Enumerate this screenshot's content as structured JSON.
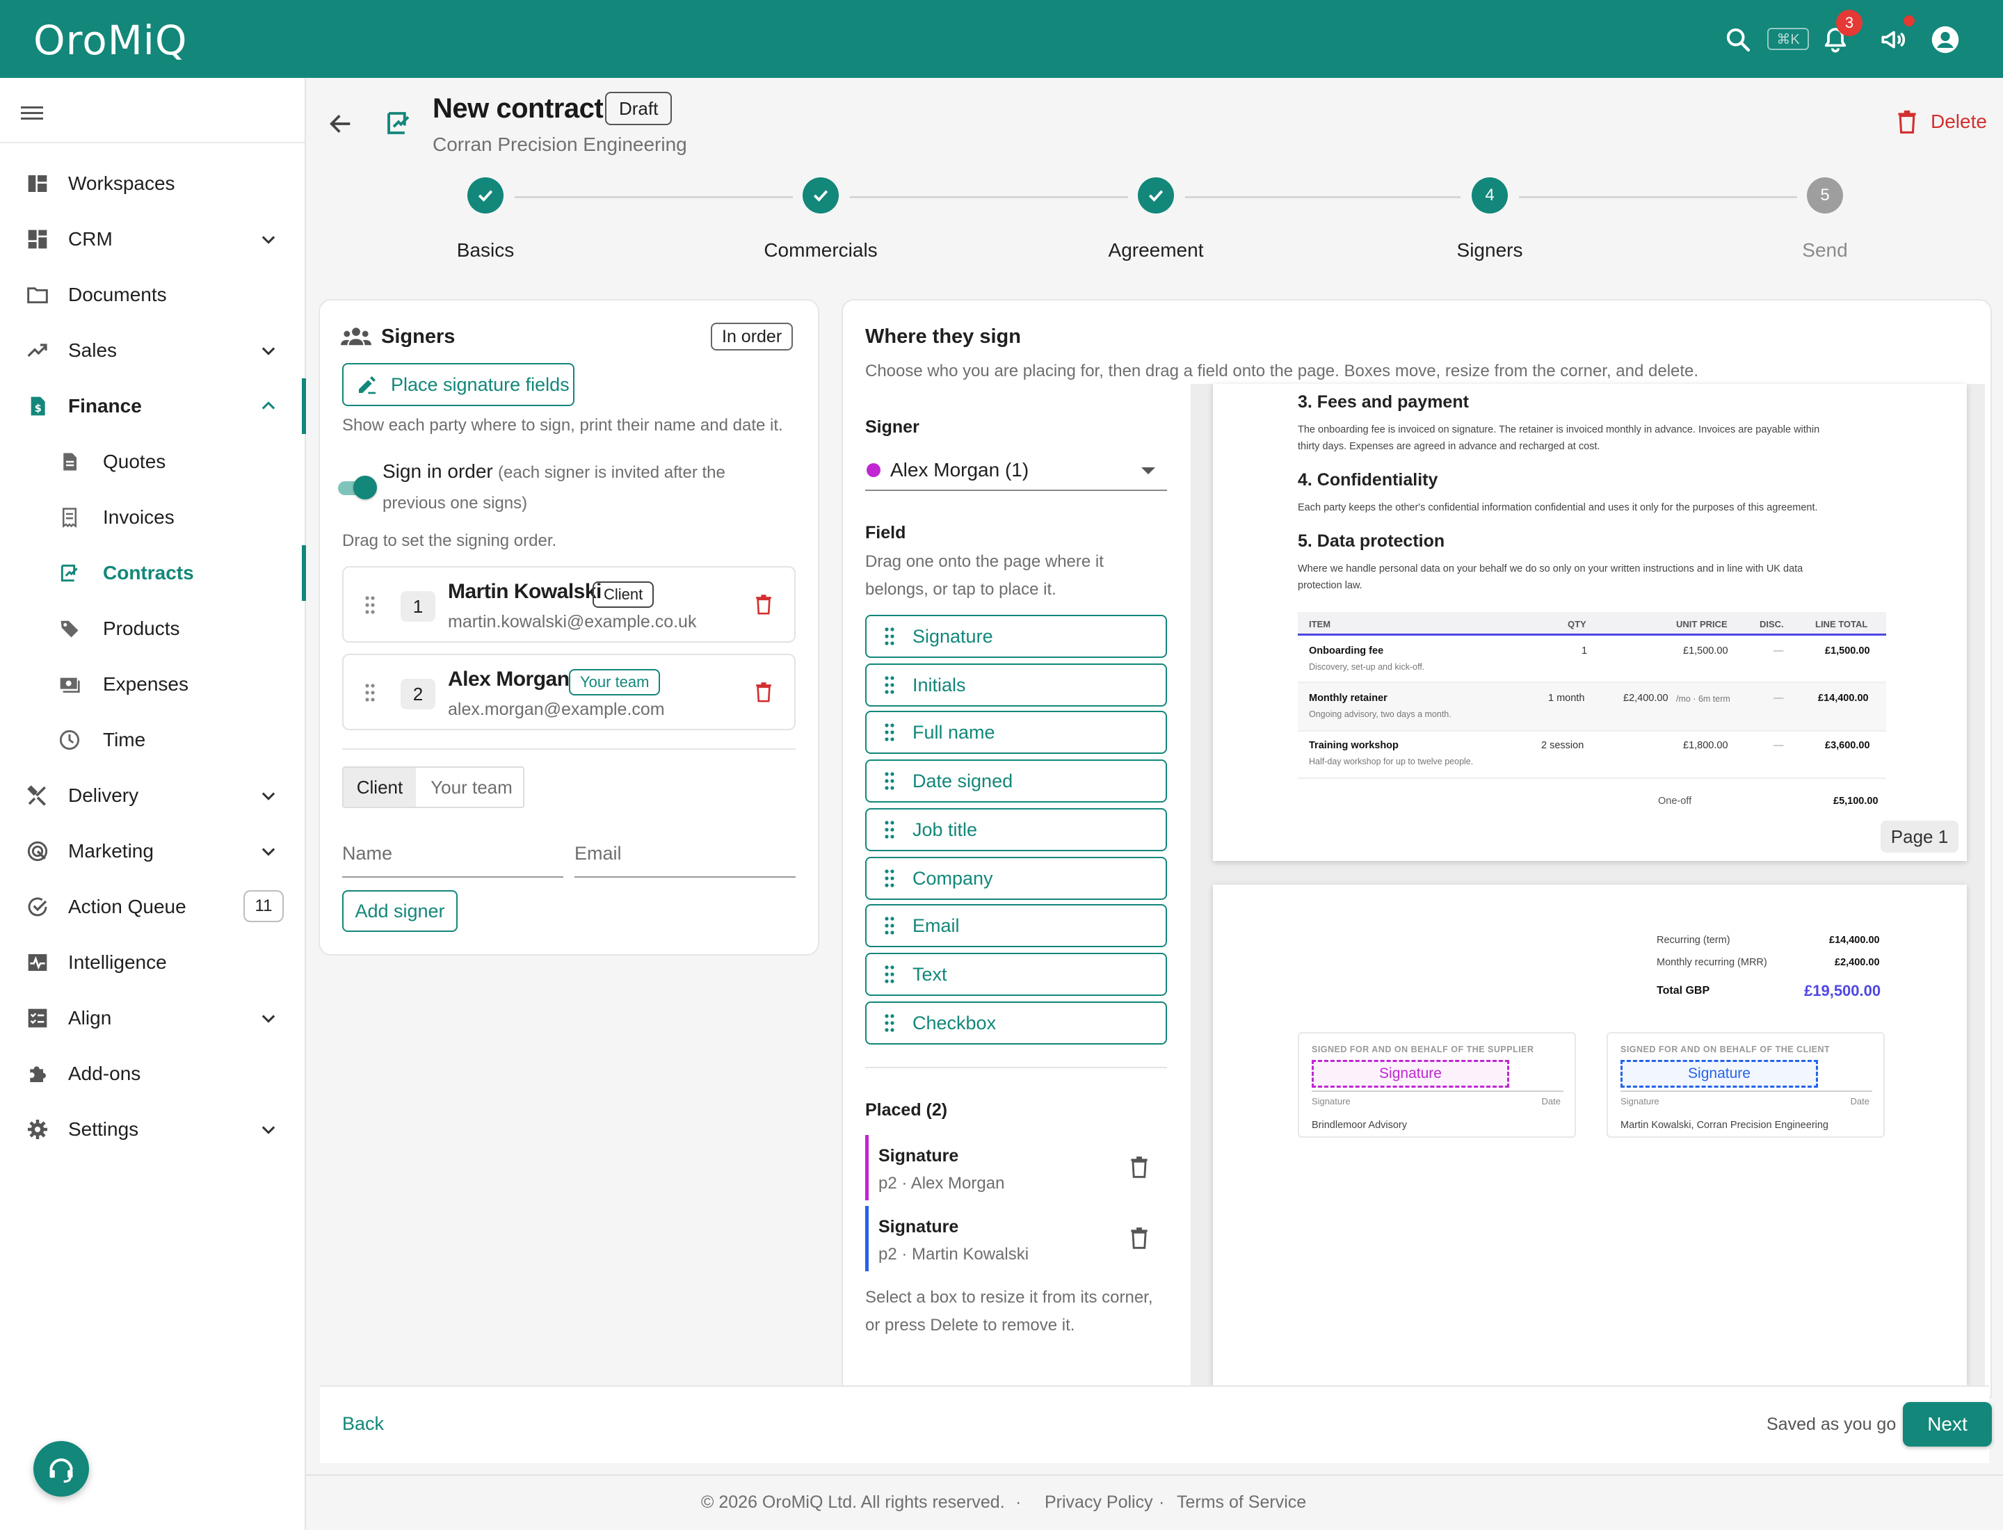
{
  "app": {
    "name": "OroMiQ"
  },
  "topbar": {
    "shortcut": "⌘K",
    "notification_count": "3"
  },
  "sidebar": {
    "items": [
      {
        "label": "Workspaces",
        "icon": "dashboard-icon"
      },
      {
        "label": "CRM",
        "icon": "grid-icon",
        "expandable": true
      },
      {
        "label": "Documents",
        "icon": "folder-icon"
      },
      {
        "label": "Sales",
        "icon": "trending-up-icon",
        "expandable": true
      },
      {
        "label": "Finance",
        "icon": "invoice-dollar-icon",
        "expanded": true
      },
      {
        "label": "Quotes",
        "icon": "document-icon",
        "sub": true
      },
      {
        "label": "Invoices",
        "icon": "receipt-icon",
        "sub": true
      },
      {
        "label": "Contracts",
        "icon": "contract-icon",
        "sub": true,
        "active": true
      },
      {
        "label": "Products",
        "icon": "tag-icon",
        "sub": true
      },
      {
        "label": "Expenses",
        "icon": "cash-icon",
        "sub": true
      },
      {
        "label": "Time",
        "icon": "clock-icon",
        "sub": true
      },
      {
        "label": "Delivery",
        "icon": "tools-icon",
        "expandable": true
      },
      {
        "label": "Marketing",
        "icon": "radar-icon",
        "expandable": true
      },
      {
        "label": "Action Queue",
        "icon": "check-circle-icon",
        "badge": "11"
      },
      {
        "label": "Intelligence",
        "icon": "pulse-icon"
      },
      {
        "label": "Align",
        "icon": "checklist-icon",
        "expandable": true
      },
      {
        "label": "Add-ons",
        "icon": "puzzle-icon"
      },
      {
        "label": "Settings",
        "icon": "gear-icon",
        "expandable": true
      }
    ]
  },
  "header": {
    "title": "New contract",
    "status": "Draft",
    "subtitle": "Corran Precision Engineering",
    "delete_label": "Delete"
  },
  "stepper": {
    "steps": [
      {
        "label": "Basics",
        "state": "done"
      },
      {
        "label": "Commercials",
        "state": "done"
      },
      {
        "label": "Agreement",
        "state": "done"
      },
      {
        "label": "Signers",
        "state": "current",
        "number": "4"
      },
      {
        "label": "Send",
        "state": "todo",
        "number": "5"
      }
    ]
  },
  "signers_panel": {
    "title": "Signers",
    "order_chip": "In order",
    "place_fields_button": "Place signature fields",
    "description": "Show each party where to sign, print their name and date it.",
    "sign_in_order_label": "Sign in order",
    "sign_in_order_hint_1": "(each signer is invited after the",
    "sign_in_order_hint_2": "previous one signs)",
    "sign_in_order_on": true,
    "drag_hint": "Drag to set the signing order.",
    "signers": [
      {
        "order": "1",
        "name": "Martin Kowalski",
        "role": "Client",
        "email": "martin.kowalski@example.co.uk"
      },
      {
        "order": "2",
        "name": "Alex Morgan",
        "role": "Your team",
        "email": "alex.morgan@example.com"
      }
    ],
    "tabs": [
      "Client",
      "Your team"
    ],
    "name_placeholder": "Name",
    "email_placeholder": "Email",
    "add_signer_button": "Add signer"
  },
  "where_panel": {
    "title": "Where they sign",
    "description": "Choose who you are placing for, then drag a field onto the page. Boxes move, resize from the corner, and delete.",
    "signer_label": "Signer",
    "signer_selected": "Alex Morgan (1)",
    "signer_color": "#c026d3",
    "field_label": "Field",
    "field_hint_1": "Drag one onto the page where it",
    "field_hint_2": "belongs, or tap to place it.",
    "fields": [
      "Signature",
      "Initials",
      "Full name",
      "Date signed",
      "Job title",
      "Company",
      "Email",
      "Text",
      "Checkbox"
    ],
    "placed_title": "Placed (2)",
    "placed": [
      {
        "type": "Signature",
        "detail": "p2 · Alex Morgan",
        "color": "#c026d3"
      },
      {
        "type": "Signature",
        "detail": "p2 · Martin Kowalski",
        "color": "#2563eb"
      }
    ],
    "placed_hint_1": "Select a box to resize it from its corner,",
    "placed_hint_2": "or press Delete to remove it."
  },
  "document": {
    "page1": {
      "h3": "3. Fees and payment",
      "p3a": "The onboarding fee is invoiced on signature. The retainer is invoiced monthly in advance. Invoices are payable within",
      "p3b": "thirty days. Expenses are agreed in advance and recharged at cost.",
      "h4": "4. Confidentiality",
      "p4": "Each party keeps the other's confidential information confidential and uses it only for the purposes of this agreement.",
      "h5": "5. Data protection",
      "p5a": "Where we handle personal data on your behalf we do so only on your written instructions and in line with UK data",
      "p5b": "protection law.",
      "columns": [
        "ITEM",
        "QTY",
        "UNIT PRICE",
        "DISC.",
        "LINE TOTAL"
      ],
      "rows": [
        {
          "item": "Onboarding fee",
          "desc": "Discovery, set-up and kick-off.",
          "qty": "1",
          "unit": "£1,500.00",
          "unit_note": "",
          "disc": "—",
          "total": "£1,500.00"
        },
        {
          "item": "Monthly retainer",
          "desc": "Ongoing advisory, two days a month.",
          "qty": "1 month",
          "unit": "£2,400.00",
          "unit_note": "/mo · 6m term",
          "disc": "—",
          "total": "£14,400.00"
        },
        {
          "item": "Training workshop",
          "desc": "Half-day workshop for up to twelve people.",
          "qty": "2 session",
          "unit": "£1,800.00",
          "unit_note": "",
          "disc": "—",
          "total": "£3,600.00"
        }
      ],
      "oneoff_label": "One-off",
      "oneoff_value": "£5,100.00",
      "page_label": "Page 1"
    },
    "page2": {
      "recurring_label": "Recurring (term)",
      "recurring_value": "£14,400.00",
      "mrr_label": "Monthly recurring (MRR)",
      "mrr_value": "£2,400.00",
      "total_label": "Total GBP",
      "total_value": "£19,500.00",
      "supplier_caption": "SIGNED FOR AND ON BEHALF OF THE SUPPLIER",
      "client_caption": "SIGNED FOR AND ON BEHALF OF THE CLIENT",
      "sig_field_label": "Signature",
      "sig_line_label": "Signature",
      "date_line_label": "Date",
      "supplier_name": "Brindlemoor Advisory",
      "client_name": "Martin Kowalski, Corran Precision Engineering"
    }
  },
  "footer_bar": {
    "back": "Back",
    "saved": "Saved as you go",
    "next": "Next"
  },
  "footer": {
    "copyright": "© 2026 OroMiQ Ltd. All rights reserved.",
    "dot": "·",
    "privacy": "Privacy Policy",
    "terms": "Terms of Service"
  },
  "colors": {
    "brand": "#12877a",
    "danger": "#d32f2f",
    "accent_purple": "#4f46e5",
    "magenta": "#c026d3",
    "blue": "#2563eb"
  }
}
